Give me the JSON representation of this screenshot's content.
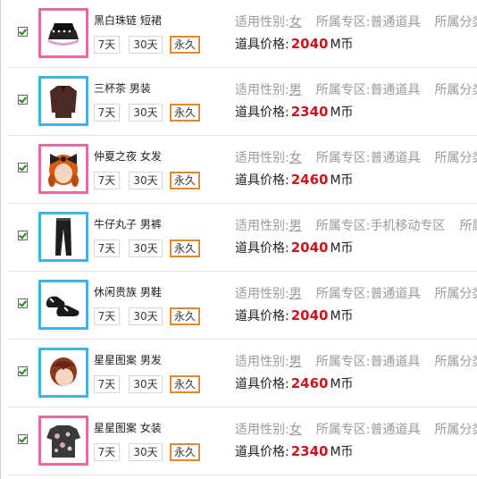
{
  "labels": {
    "gender": "适用性别:",
    "zone": "所属专区:",
    "category": "所属分类",
    "price": "道具价格:",
    "currency": "M币"
  },
  "items": [
    {
      "name": "黑白珠链 短裙",
      "gender": "女",
      "zone": "普通道具",
      "category_text": "所属分类",
      "price": "2040",
      "durations": [
        "7天",
        "30天",
        "永久"
      ],
      "selected": true,
      "thumb": "skirt",
      "thumb_color": "pink"
    },
    {
      "name": "三杯茶 男装",
      "gender": "男",
      "zone": "普通道具",
      "category_text": "所属分类",
      "price": "2340",
      "durations": [
        "7天",
        "30天",
        "永久"
      ],
      "selected": true,
      "thumb": "shirt",
      "thumb_color": "blue"
    },
    {
      "name": "仲夏之夜 女发",
      "gender": "女",
      "zone": "普通道具",
      "category_text": "所属分类",
      "price": "2460",
      "durations": [
        "7天",
        "30天",
        "永久"
      ],
      "selected": true,
      "thumb": "female-hair",
      "thumb_color": "pink"
    },
    {
      "name": "牛仔丸子 男裤",
      "gender": "男",
      "zone": "手机移动专区",
      "category_text": "所属",
      "price": "2040",
      "durations": [
        "7天",
        "30天",
        "永久"
      ],
      "selected": true,
      "thumb": "pants",
      "thumb_color": "blue"
    },
    {
      "name": "休闲贵族 男鞋",
      "gender": "男",
      "zone": "普通道具",
      "category_text": "所属分类",
      "price": "2040",
      "durations": [
        "7天",
        "30天",
        "永久"
      ],
      "selected": true,
      "thumb": "shoes",
      "thumb_color": "blue"
    },
    {
      "name": "星星图案 男发",
      "gender": "男",
      "zone": "普通道具",
      "category_text": "所属分类",
      "price": "2460",
      "durations": [
        "7天",
        "30天",
        "永久"
      ],
      "selected": true,
      "thumb": "male-hair",
      "thumb_color": "blue"
    },
    {
      "name": "星星图案 女装",
      "gender": "女",
      "zone": "普通道具",
      "category_text": "所属分类",
      "price": "2340",
      "durations": [
        "7天",
        "30天",
        "永久"
      ],
      "selected": true,
      "thumb": "top",
      "thumb_color": "pink"
    }
  ],
  "colors": {
    "pink_frame": "#e86aa3",
    "blue_frame": "#3fb3e6",
    "price": "#c8161d",
    "selected_duration": "#e08a2a"
  }
}
